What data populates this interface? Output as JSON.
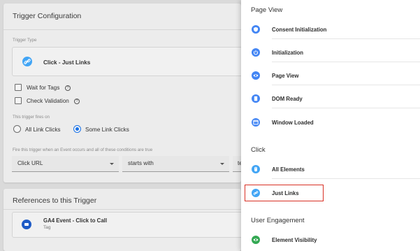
{
  "trigger_config": {
    "title": "Trigger Configuration",
    "trigger_type_label": "Trigger Type",
    "trigger_type_value": "Click - Just Links",
    "wait_for_tags_label": "Wait for Tags",
    "check_validation_label": "Check Validation",
    "fires_on_label": "This trigger fires on",
    "all_link_clicks_label": "All Link Clicks",
    "some_link_clicks_label": "Some Link Clicks",
    "fires_on_selected": "Some Link Clicks",
    "condition_label": "Fire this trigger when an Event occurs and all of these conditions are true",
    "condition_variable": "Click URL",
    "condition_operator": "starts with",
    "condition_value_partial": "te"
  },
  "references": {
    "title": "References to this Trigger",
    "item_name": "GA4 Event - Click to Call",
    "item_type": "Tag"
  },
  "trigger_picker": {
    "sections": [
      {
        "title": "Page View",
        "items": [
          "Consent Initialization",
          "Initialization",
          "Page View",
          "DOM Ready",
          "Window Loaded"
        ]
      },
      {
        "title": "Click",
        "items": [
          "All Elements",
          "Just Links"
        ]
      },
      {
        "title": "User Engagement",
        "items": [
          "Element Visibility"
        ]
      }
    ],
    "highlighted_item": "Just Links"
  },
  "colors": {
    "accent_blue": "#1a73e8",
    "highlight_red": "#d93025",
    "icon_blue": "#4285f4",
    "icon_light_blue": "#42a5f5",
    "icon_dark_blue": "#1e5bc6",
    "icon_green": "#34a853"
  }
}
